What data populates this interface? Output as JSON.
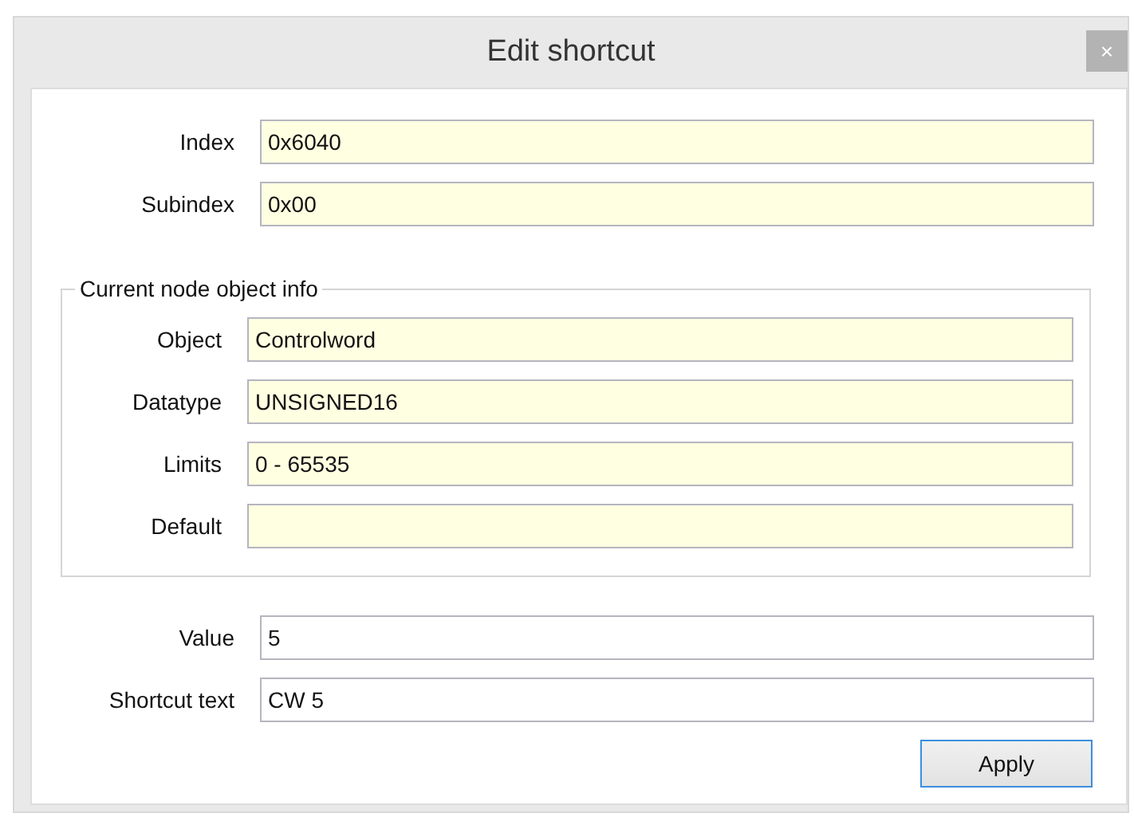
{
  "window": {
    "title": "Edit shortcut",
    "close": "×"
  },
  "top_fields": [
    {
      "label": "Index",
      "value": "0x6040",
      "readonly": true
    },
    {
      "label": "Subindex",
      "value": "0x00",
      "readonly": true
    }
  ],
  "group": {
    "title": "Current node object info",
    "fields": [
      {
        "label": "Object",
        "value": "Controlword",
        "readonly": true
      },
      {
        "label": "Datatype",
        "value": "UNSIGNED16",
        "readonly": true
      },
      {
        "label": "Limits",
        "value": "0 - 65535",
        "readonly": true
      },
      {
        "label": "Default",
        "readonly": true
      }
    ]
  },
  "bottom_fields": [
    {
      "label": "Value",
      "value": "5",
      "readonly": false
    },
    {
      "label": "Shortcut text",
      "value": "CW 5",
      "readonly": false
    }
  ],
  "buttons": [
    {
      "label": "Apply"
    }
  ]
}
